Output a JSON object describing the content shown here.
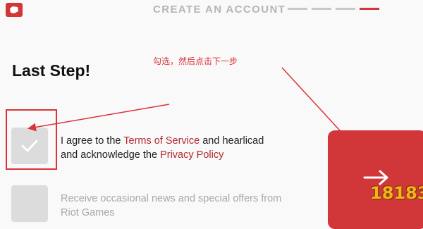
{
  "header": {
    "title": "CREATE AN ACCOUNT",
    "progress_total": 4,
    "progress_current": 4
  },
  "annotation": {
    "text": "勾选，然后点击下一步",
    "color": "#d9343a"
  },
  "page_title": "Last Step!",
  "terms": {
    "checked": true,
    "text_1": "I agree to the ",
    "link_1": "Terms of Service",
    "text_2": " and hearlicad",
    "text_3": "and acknowledge the ",
    "link_2": "Privacy Policy"
  },
  "news": {
    "checked": false,
    "text": "Receive occasional news and special offers from Riot Games"
  },
  "next_button": {
    "icon": "arrow-right-icon",
    "color": "#d13639"
  },
  "watermark": {
    "text": "18183"
  },
  "colors": {
    "accent": "#d13639",
    "annotation": "#d9343a",
    "link": "#b12a2e"
  }
}
